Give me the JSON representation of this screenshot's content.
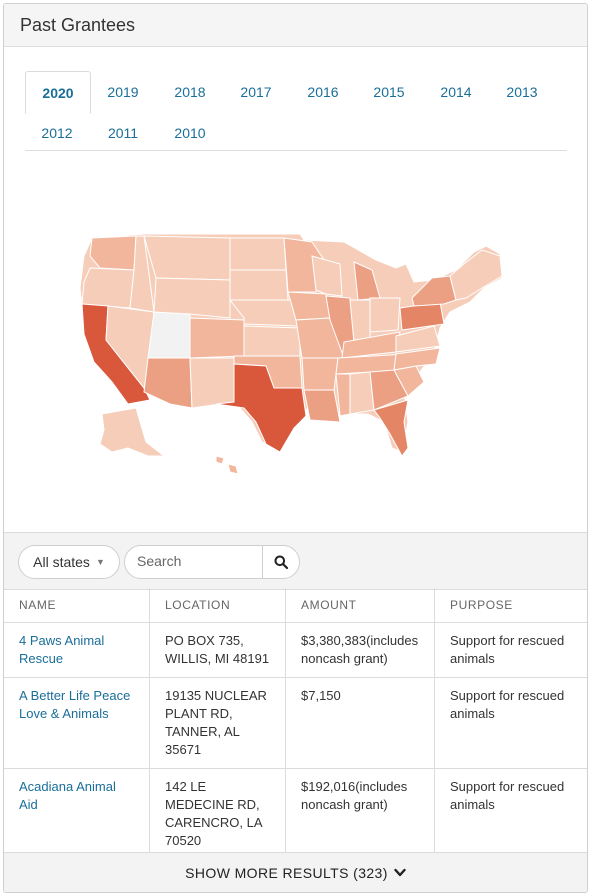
{
  "panel": {
    "title": "Past Grantees"
  },
  "tabs": [
    "2020",
    "2019",
    "2018",
    "2017",
    "2016",
    "2015",
    "2014",
    "2013",
    "2012",
    "2011",
    "2010"
  ],
  "active_tab": "2020",
  "filters": {
    "state_select": "All states",
    "search_placeholder": "Search"
  },
  "table": {
    "headers": [
      "NAME",
      "LOCATION",
      "AMOUNT",
      "PURPOSE"
    ],
    "rows": [
      {
        "name": "4 Paws Animal Rescue",
        "location": "PO BOX 735, WILLIS, MI 48191",
        "amount": "$3,380,383(includes noncash grant)",
        "purpose": "Support for rescued animals"
      },
      {
        "name": "A Better Life Peace Love & Animals",
        "location": "19135 NUCLEAR PLANT RD, TANNER, AL 35671",
        "amount": "$7,150",
        "purpose": "Support for rescued animals"
      },
      {
        "name": "Acadiana Animal Aid",
        "location": "142 LE MEDECINE RD, CARENCRO, LA 70520",
        "amount": "$192,016(includes noncash grant)",
        "purpose": "Support for rescued animals"
      }
    ]
  },
  "show_more": "SHOW MORE RESULTS (323)",
  "map": {
    "colors": {
      "none": "#f2f2f2",
      "light": "#f6cdb8",
      "mid1": "#f2b69c",
      "mid2": "#eca083",
      "mid3": "#e48566",
      "high": "#d9573a"
    }
  }
}
